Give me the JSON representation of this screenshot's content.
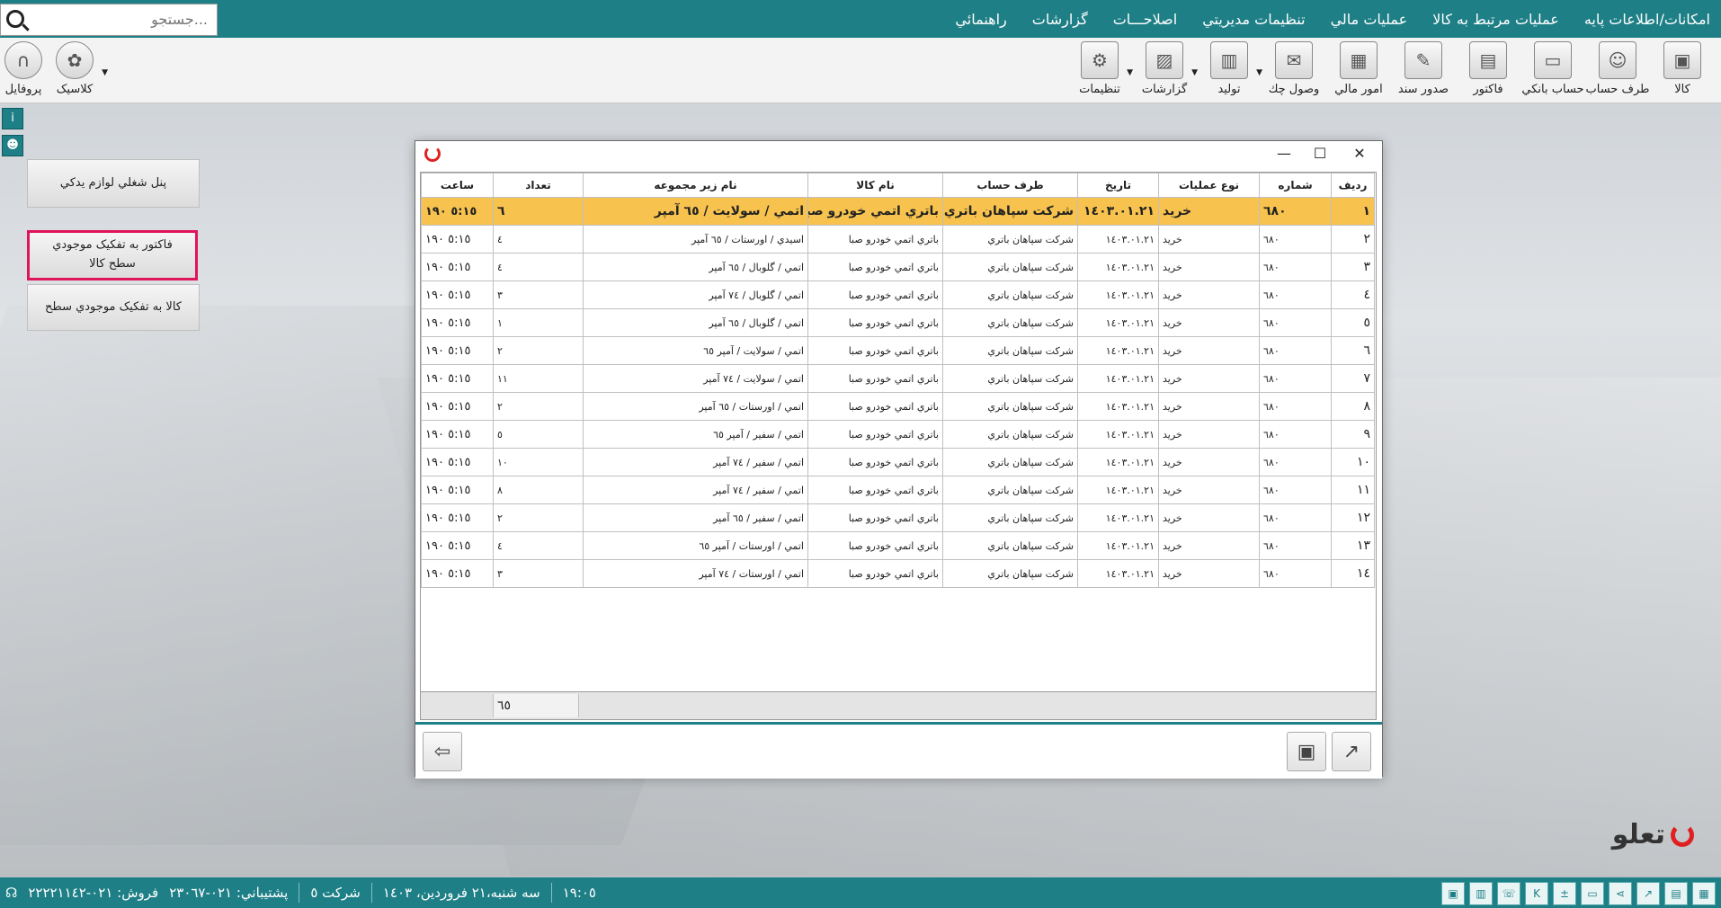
{
  "menu": {
    "items": [
      "امکانات/اطلاعات پايه",
      "عمليات مرتبط به کالا",
      "عمليات مالي",
      "تنظيمات مديريتي",
      "اصلاحـــات",
      "گزارشات",
      "راهنمائي"
    ],
    "search_placeholder": "جستجو..."
  },
  "toolbar": {
    "right": [
      {
        "label": "کالا",
        "icon": "box-icon"
      },
      {
        "label": "طرف حساب",
        "icon": "person-icon"
      },
      {
        "label": "حساب بانکي",
        "icon": "bank-card-icon"
      },
      {
        "label": "فاکتور",
        "icon": "invoice-icon"
      },
      {
        "label": "صدور سند",
        "icon": "document-edit-icon"
      },
      {
        "label": "امور مالي",
        "icon": "calculator-icon"
      },
      {
        "label": "وصول چك",
        "icon": "check-envelope-icon"
      },
      {
        "label": "توليد",
        "icon": "production-icon"
      },
      {
        "label": "گزارشات",
        "icon": "report-chart-icon"
      },
      {
        "label": "تنظيمات",
        "icon": "gear-icon"
      }
    ],
    "left": [
      {
        "label": "پروفايل",
        "icon": "profile-icon"
      },
      {
        "label": "کلاسيک",
        "icon": "palette-icon"
      }
    ]
  },
  "left_panel": {
    "btn1": "پنل شغلي لوازم يدكي",
    "btn2": "فاکتور به تفکيک موجودي سطح کالا",
    "btn3": "کالا به تفکيک موجودي سطح"
  },
  "grid": {
    "columns": [
      "رديف",
      "شماره",
      "نوع عمليات",
      "تاريخ",
      "طرف حساب",
      "نام کالا",
      "نام زير مجموعه",
      "تعداد",
      "ساعت"
    ],
    "rows": [
      [
        "١",
        "٦٨٠",
        "خريد",
        "١٤٠٣.٠١.٢١",
        "شرکت سپاهان باتري",
        "باتري اتمي خودرو صبا",
        "اتمي / سولايت / ٦٥ آمپر",
        "٦",
        "٥:١٥ ١٩٠"
      ],
      [
        "٢",
        "٦٨٠",
        "خريد",
        "١٤٠٣.٠١.٢١",
        "شرکت سپاهان باتري",
        "باتري اتمي خودرو صبا",
        "اسيدي / اورستات / ٦٥ آمپر",
        "٤",
        "٥:١٥ ١٩٠"
      ],
      [
        "٣",
        "٦٨٠",
        "خريد",
        "١٤٠٣.٠١.٢١",
        "شرکت سپاهان باتري",
        "باتري اتمي خودرو صبا",
        "اتمي / گلوبال / ٦٥ آمپر",
        "٤",
        "٥:١٥ ١٩٠"
      ],
      [
        "٤",
        "٦٨٠",
        "خريد",
        "١٤٠٣.٠١.٢١",
        "شرکت سپاهان باتري",
        "باتري اتمي خودرو صبا",
        "اتمي / گلوبال / ٧٤ آمپر",
        "٣",
        "٥:١٥ ١٩٠"
      ],
      [
        "٥",
        "٦٨٠",
        "خريد",
        "١٤٠٣.٠١.٢١",
        "شرکت سپاهان باتري",
        "باتري اتمي خودرو صبا",
        "اتمي / گلوبال / ٦٥ آمپر",
        "١",
        "٥:١٥ ١٩٠"
      ],
      [
        "٦",
        "٦٨٠",
        "خريد",
        "١٤٠٣.٠١.٢١",
        "شرکت سپاهان باتري",
        "باتري اتمي خودرو صبا",
        "اتمي / سولايت / آمپر ٦٥",
        "٢",
        "٥:١٥ ١٩٠"
      ],
      [
        "٧",
        "٦٨٠",
        "خريد",
        "١٤٠٣.٠١.٢١",
        "شرکت سپاهان باتري",
        "باتري اتمي خودرو صبا",
        "اتمي / سولايت / ٧٤ آمپر",
        "١١",
        "٥:١٥ ١٩٠"
      ],
      [
        "٨",
        "٦٨٠",
        "خريد",
        "١٤٠٣.٠١.٢١",
        "شرکت سپاهان باتري",
        "باتري اتمي خودرو صبا",
        "اتمي / اورستات / ٦٥ آمپر",
        "٢",
        "٥:١٥ ١٩٠"
      ],
      [
        "٩",
        "٦٨٠",
        "خريد",
        "١٤٠٣.٠١.٢١",
        "شرکت سپاهان باتري",
        "باتري اتمي خودرو صبا",
        "اتمي / سفير / آمپر ٦٥",
        "٥",
        "٥:١٥ ١٩٠"
      ],
      [
        "١٠",
        "٦٨٠",
        "خريد",
        "١٤٠٣.٠١.٢١",
        "شرکت سپاهان باتري",
        "باتري اتمي خودرو صبا",
        "اتمي / سفير / ٧٤ آمپر",
        "١٠",
        "٥:١٥ ١٩٠"
      ],
      [
        "١١",
        "٦٨٠",
        "خريد",
        "١٤٠٣.٠١.٢١",
        "شرکت سپاهان باتري",
        "باتري اتمي خودرو صبا",
        "اتمي / سفير / ٧٤ آمپر",
        "٨",
        "٥:١٥ ١٩٠"
      ],
      [
        "١٢",
        "٦٨٠",
        "خريد",
        "١٤٠٣.٠١.٢١",
        "شرکت سپاهان باتري",
        "باتري اتمي خودرو صبا",
        "اتمي / سفير / ٦٥ آمپر",
        "٢",
        "٥:١٥ ١٩٠"
      ],
      [
        "١٣",
        "٦٨٠",
        "خريد",
        "١٤٠٣.٠١.٢١",
        "شرکت سپاهان باتري",
        "باتري اتمي خودرو صبا",
        "اتمي / اورستات / آمپر ٦٥",
        "٤",
        "٥:١٥ ١٩٠"
      ],
      [
        "١٤",
        "٦٨٠",
        "خريد",
        "١٤٠٣.٠١.٢١",
        "شرکت سپاهان باتري",
        "باتري اتمي خودرو صبا",
        "اتمي / اورستات / ٧٤ آمپر",
        "٣",
        "٥:١٥ ١٩٠"
      ]
    ],
    "total_qty": "٦٥"
  },
  "brand": {
    "name": "تعلو"
  },
  "status": {
    "time": "١٩:٠٥",
    "date": "سه شنبه،٢١ فروردين، ١٤٠٣",
    "company": "شرکت ٥",
    "support": "پشتيباني: ٠٢١-٢٣٠٦٧",
    "sales": "فروش: ٠٢١-٢٢٢٢١١٤٢"
  },
  "colors": {
    "accent": "#1e7f86",
    "selected_row": "#f7c34e",
    "highlight_border": "#e0145a"
  }
}
